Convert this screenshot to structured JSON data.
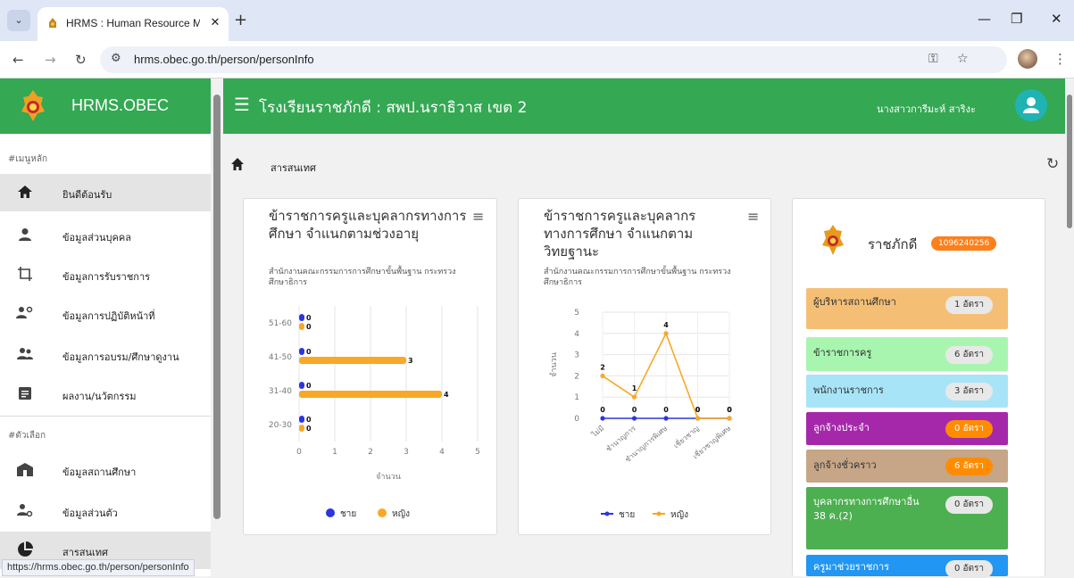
{
  "browser": {
    "tab_title": "HRMS : Human Resource Mana",
    "url": "hrms.obec.go.th/person/personInfo",
    "status_url": "https://hrms.obec.go.th/person/personInfo"
  },
  "sidebar": {
    "brand": "HRMS.OBEC",
    "section_main": "#เมนูหลัก",
    "section_options": "#ตัวเลือก",
    "items": [
      {
        "label": "ยินดีต้อนรับ",
        "icon": "home-icon"
      },
      {
        "label": "ข้อมูลส่วนบุคคล",
        "icon": "person-icon"
      },
      {
        "label": "ข้อมูลการรับราชการ",
        "icon": "crop-icon"
      },
      {
        "label": "ข้อมูลการปฏิบัติหน้าที่",
        "icon": "people-gear-icon"
      },
      {
        "label": "ข้อมูลการอบรม/ศึกษาดูงาน",
        "icon": "group-icon"
      },
      {
        "label": "ผลงาน/นวัตกรรม",
        "icon": "document-icon"
      }
    ],
    "options": [
      {
        "label": "ข้อมูลสถานศึกษา",
        "icon": "school-icon"
      },
      {
        "label": "ข้อมูลส่วนตัว",
        "icon": "person-settings-icon"
      },
      {
        "label": "สารสนเทศ",
        "icon": "pie-chart-icon"
      }
    ]
  },
  "header": {
    "school_title": "โรงเรียนราชภักดี : สพป.นราธิวาส เขต 2",
    "user_name": "นางสาวการีมะห์ สาริงะ"
  },
  "breadcrumb": "สารสนเทศ",
  "cards": {
    "age": {
      "title": "ข้าราชการครูและบุคลากรทางการศึกษา จำแนกตามช่วงอายุ",
      "subtitle": "สำนักงานคณะกรรมการการศึกษาขั้นพื้นฐาน กระทรวงศึกษาธิการ"
    },
    "rank": {
      "title": "ข้าราชการครูและบุคลากรทางการศึกษา จำแนกตามวิทยฐานะ",
      "subtitle": "สำนักงานคณะกรรมการการศึกษาขั้นพื้นฐาน กระทรวงศึกษาธิการ"
    }
  },
  "chart_data": [
    {
      "type": "bar",
      "orientation": "horizontal",
      "categories": [
        "51-60",
        "41-50",
        "31-40",
        "20-30"
      ],
      "series": [
        {
          "name": "ชาย",
          "values": [
            0,
            0,
            0,
            0
          ],
          "color": "#2b35e0"
        },
        {
          "name": "หญิง",
          "values": [
            0,
            3,
            4,
            0
          ],
          "color": "#f9a825"
        }
      ],
      "xlabel": "จำนวน",
      "xlim": [
        0,
        5
      ],
      "xticks": [
        0,
        1,
        2,
        3,
        4,
        5
      ],
      "legend": "bottom",
      "grid": true
    },
    {
      "type": "line",
      "categories": [
        "ไม่มี",
        "ชำนาญการ",
        "ชำนาญการพิเศษ",
        "เชี่ยวชาญ",
        "เชี่ยวชาญพิเศษ"
      ],
      "series": [
        {
          "name": "ชาย",
          "values": [
            0,
            0,
            0,
            0,
            0
          ],
          "color": "#2b35e0"
        },
        {
          "name": "หญิง",
          "values": [
            2,
            1,
            4,
            0,
            0
          ],
          "color": "#f9a825"
        }
      ],
      "ylabel": "จำนวน",
      "ylim": [
        0,
        5
      ],
      "yticks": [
        0,
        1,
        2,
        3,
        4,
        5
      ],
      "legend": "bottom",
      "grid": true
    }
  ],
  "org": {
    "name": "ราชภักดี",
    "code": "1096240256",
    "stats": [
      {
        "label": "ผู้บริหารสถานศึกษา",
        "badge": "1 อัตรา",
        "bg": "#f4bf75",
        "badge_bg": "#e8e8e8",
        "badge_fg": "#333"
      },
      {
        "label": "ข้าราชการครู",
        "badge": "6 อัตรา",
        "bg": "#a8f5b0",
        "badge_bg": "#e8e8e8",
        "badge_fg": "#333"
      },
      {
        "label": "พนักงานราชการ",
        "badge": "3 อัตรา",
        "bg": "#a8e4f7",
        "badge_bg": "#e8e8e8",
        "badge_fg": "#333"
      },
      {
        "label": "ลูกจ้างประจำ",
        "badge": "0 อัตรา",
        "bg": "#a528ab",
        "badge_bg": "#ff8c00",
        "badge_fg": "#fff"
      },
      {
        "label": "ลูกจ้างชั่วคราว",
        "badge": "6 อัตรา",
        "bg": "#c6a686",
        "badge_bg": "#ff8c00",
        "badge_fg": "#fff"
      },
      {
        "label": "บุคลากรทางการศึกษาอื่น 38 ค.(2)",
        "badge": "0 อัตรา",
        "bg": "#4caf50",
        "badge_bg": "#e8e8e8",
        "badge_fg": "#333"
      },
      {
        "label": "ครูมาช่วยราชการ",
        "badge": "0 อัตรา",
        "bg": "#2196f3",
        "badge_bg": "#e8e8e8",
        "badge_fg": "#333"
      }
    ]
  }
}
